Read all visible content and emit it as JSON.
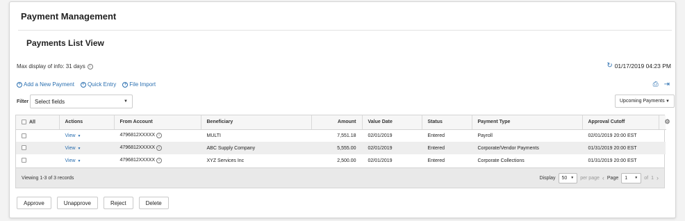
{
  "page": {
    "title": "Payment Management",
    "subtitle": "Payments List View"
  },
  "info": {
    "max_display": "Max display of info: 31 days",
    "timestamp": "01/17/2019 04:23 PM",
    "info_icon": "i"
  },
  "actions": {
    "add_new": "Add a New Payment",
    "quick_entry": "Quick Entry",
    "file_import": "File Import"
  },
  "filter": {
    "label": "Filter",
    "placeholder": "Select fields",
    "view_select": "Upcoming Payments"
  },
  "table": {
    "select_all_label": "All",
    "headers": {
      "actions": "Actions",
      "from_account": "From Account",
      "beneficiary": "Beneficiary",
      "amount": "Amount",
      "value_date": "Value Date",
      "status": "Status",
      "payment_type": "Payment Type",
      "approval_cutoff": "Approval Cutoff"
    },
    "rows": [
      {
        "action": "View",
        "from_account": "4796812XXXXX",
        "beneficiary": "MULTI",
        "amount": "7,551.18",
        "value_date": "02/01/2019",
        "status": "Entered",
        "payment_type": "Payroll",
        "approval_cutoff": "02/01/2019 20:00 EST"
      },
      {
        "action": "View",
        "from_account": "4796812XXXXX",
        "beneficiary": "ABC Supply Company",
        "amount": "5,555.00",
        "value_date": "02/01/2019",
        "status": "Entered",
        "payment_type": "Corporate/Vendor Payments",
        "approval_cutoff": "01/31/2019 20:00 EST"
      },
      {
        "action": "View",
        "from_account": "4796812XXXXX",
        "beneficiary": "XYZ Services Inc",
        "amount": "2,500.00",
        "value_date": "02/01/2019",
        "status": "Entered",
        "payment_type": "Corporate Collections",
        "approval_cutoff": "01/31/2019 20:00 EST"
      }
    ]
  },
  "pagination": {
    "viewing": "Viewing 1-3 of 3 records",
    "display_label": "Display",
    "per_page_value": "50",
    "per_page_label": "per page",
    "page_label": "Page",
    "page_value": "1",
    "of_label": "of",
    "total_pages": "1"
  },
  "buttons": {
    "approve": "Approve",
    "unapprove": "Unapprove",
    "reject": "Reject",
    "delete": "Delete"
  },
  "colors": {
    "link": "#2a6fb0",
    "row_alt": "#eeeeee",
    "footer": "#e9e9e9"
  }
}
